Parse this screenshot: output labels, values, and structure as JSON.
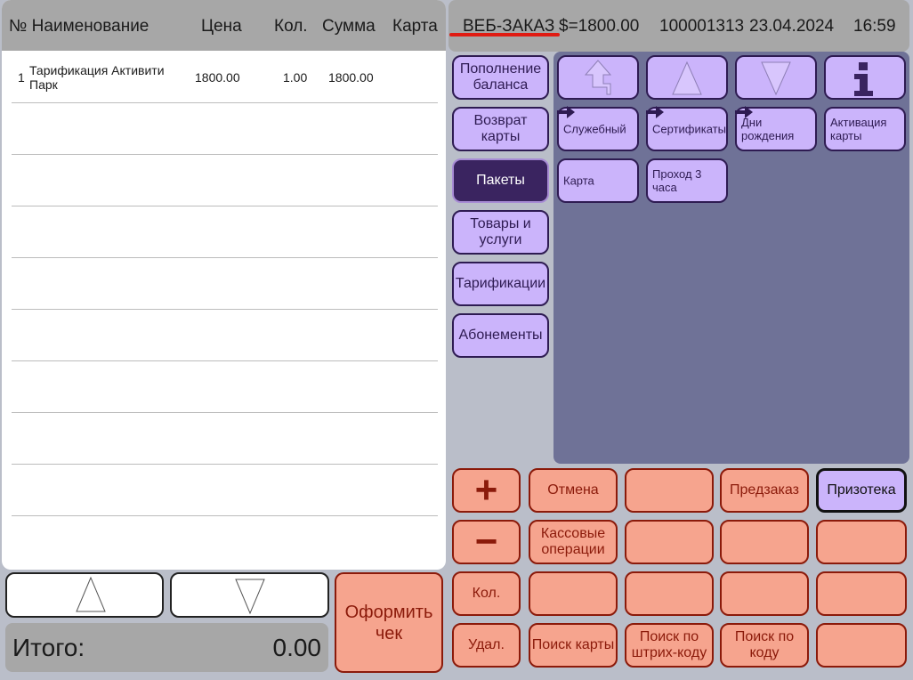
{
  "order": {
    "headers": {
      "no_name": "№ Наименование",
      "price": "Цена",
      "qty": "Кол.",
      "sum": "Сумма",
      "card": "Карта"
    },
    "rows": [
      {
        "no": "1",
        "name": "Тарификация Активити Парк",
        "price": "1800.00",
        "qty": "1.00",
        "sum": "1800.00",
        "card": ""
      }
    ]
  },
  "nav": {
    "up_icon": "triangle-up-outline",
    "down_icon": "triangle-down-outline"
  },
  "total": {
    "label": "Итого:",
    "value": "0.00"
  },
  "checkout": {
    "label": "Оформить чек"
  },
  "topbar": {
    "mode": "ВЕБ-ЗАКАЗ",
    "amount": "$=1800.00",
    "order_no": "100001313",
    "date": "23.04.2024",
    "time": "16:59",
    "mode_underline_color": "#e01b12"
  },
  "categories": [
    {
      "label": "Пополнение баланса",
      "active": false
    },
    {
      "label": "Возврат карты",
      "active": false
    },
    {
      "label": "Пакеты",
      "active": true
    },
    {
      "label": "Товары и услуги",
      "active": false
    },
    {
      "label": "Тарификации",
      "active": false
    },
    {
      "label": "Абонементы",
      "active": false
    }
  ],
  "grid": {
    "nav_icons": [
      "up-arrow-outline",
      "triangle-up-outline",
      "triangle-down-outline",
      "info-icon"
    ],
    "items": [
      {
        "label": "Служебный",
        "folder": true
      },
      {
        "label": "Сертификаты",
        "folder": true
      },
      {
        "label": "Дни рождения",
        "folder": true
      },
      {
        "label": "Активация карты",
        "folder": false
      },
      {
        "label": "Карта",
        "folder": false
      },
      {
        "label": "Проход 3 часа",
        "folder": false
      }
    ]
  },
  "keypad": {
    "plus": "+",
    "minus": "−",
    "cancel": "Отмена",
    "preorder": "Предзаказ",
    "prizoteka": "Призотека",
    "cash_ops": "Кассовые операции",
    "qty": "Кол.",
    "delete": "Удал.",
    "search_card": "Поиск карты",
    "search_barcode": "Поиск по штрих-коду",
    "search_code": "Поиск по коду"
  },
  "colors": {
    "background": "#babec9",
    "header_gray": "#a7a7a7",
    "lavender": "#cbb4fb",
    "lavender_active": "#3a2460",
    "grid_panel": "#6f7297",
    "salmon": "#f6a48e",
    "salmon_border": "#8b1a0a"
  }
}
